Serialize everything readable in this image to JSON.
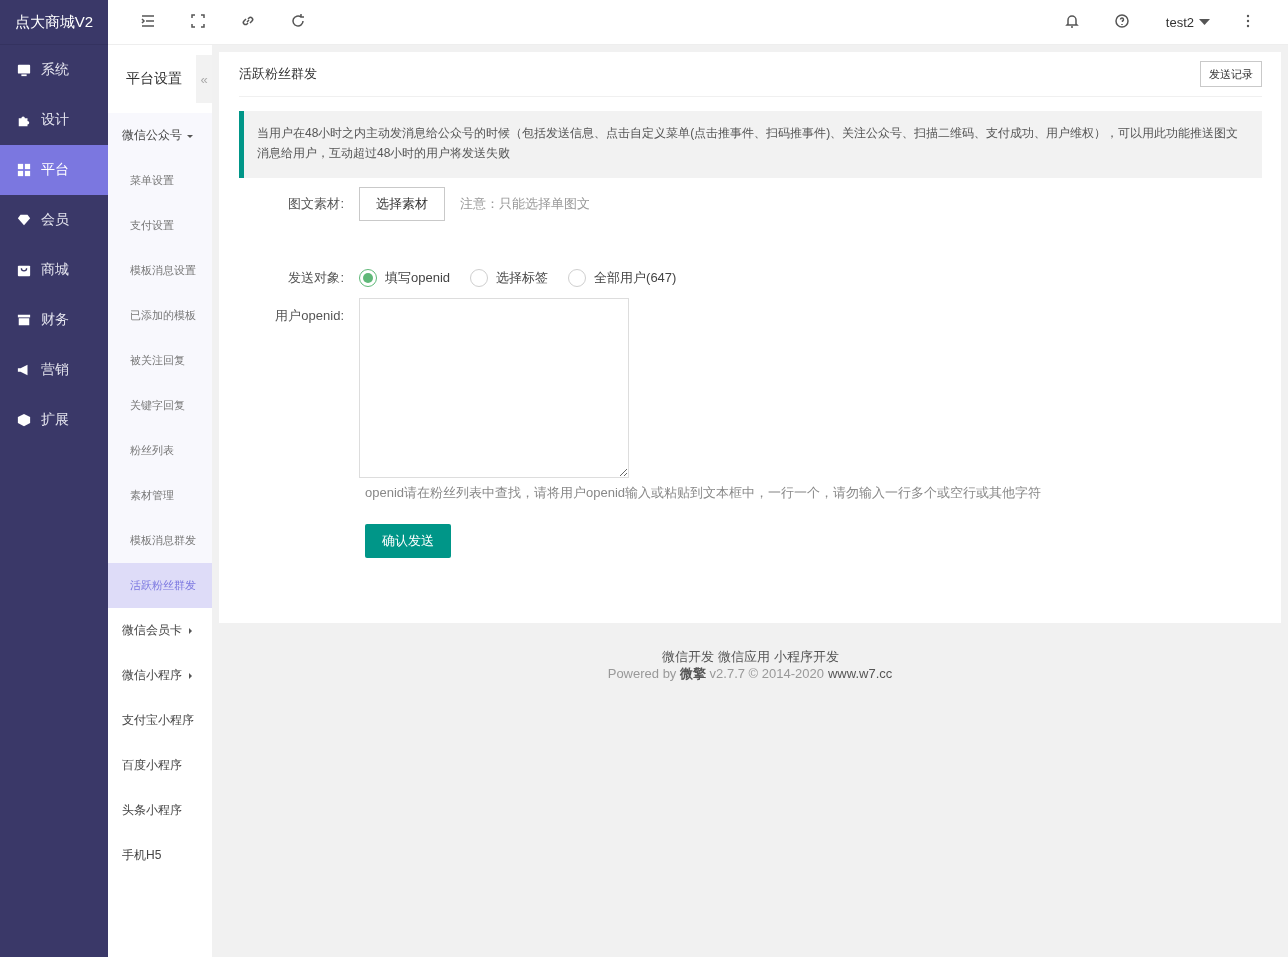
{
  "brand": "点大商城V2",
  "nav": [
    {
      "label": "系统",
      "selected": false
    },
    {
      "label": "设计",
      "selected": false
    },
    {
      "label": "平台",
      "selected": true
    },
    {
      "label": "会员",
      "selected": false
    },
    {
      "label": "商城",
      "selected": false
    },
    {
      "label": "财务",
      "selected": false
    },
    {
      "label": "营销",
      "selected": false
    },
    {
      "label": "扩展",
      "selected": false
    }
  ],
  "topbar": {
    "user": "test2"
  },
  "submenu": {
    "title": "平台设置",
    "collapse": "«",
    "groups": [
      {
        "label": "微信公众号",
        "expanded": true,
        "children": [
          {
            "label": "菜单设置",
            "selected": false
          },
          {
            "label": "支付设置",
            "selected": false
          },
          {
            "label": "模板消息设置",
            "selected": false
          },
          {
            "label": "已添加的模板",
            "selected": false
          },
          {
            "label": "被关注回复",
            "selected": false
          },
          {
            "label": "关键字回复",
            "selected": false
          },
          {
            "label": "粉丝列表",
            "selected": false
          },
          {
            "label": "素材管理",
            "selected": false
          },
          {
            "label": "模板消息群发",
            "selected": false
          },
          {
            "label": "活跃粉丝群发",
            "selected": true
          }
        ]
      },
      {
        "label": "微信会员卡",
        "expanded": false,
        "has_children": true
      },
      {
        "label": "微信小程序",
        "expanded": false,
        "has_children": true
      },
      {
        "label": "支付宝小程序",
        "expanded": false,
        "has_children": false
      },
      {
        "label": "百度小程序",
        "expanded": false,
        "has_children": false
      },
      {
        "label": "头条小程序",
        "expanded": false,
        "has_children": false
      },
      {
        "label": "手机H5",
        "expanded": false,
        "has_children": false
      }
    ]
  },
  "page": {
    "title": "活跃粉丝群发",
    "record_button": "发送记录",
    "notice": "当用户在48小时之内主动发消息给公众号的时候（包括发送信息、点击自定义菜单(点击推事件、扫码推事件)、关注公众号、扫描二维码、支付成功、用户维权），可以用此功能推送图文消息给用户，互动超过48小时的用户将发送失败",
    "material": {
      "label": "图文素材:",
      "button": "选择素材",
      "note": "注意：只能选择单图文"
    },
    "target": {
      "label": "发送对象:",
      "options": [
        {
          "label": "填写openid",
          "selected": true
        },
        {
          "label": "选择标签",
          "selected": false
        },
        {
          "label": "全部用户(647)",
          "selected": false
        }
      ]
    },
    "openid": {
      "label": "用户openid:",
      "help": "openid请在粉丝列表中查找，请将用户openid输入或粘贴到文本框中，一行一个，请勿输入一行多个或空行或其他字符"
    },
    "submit": "确认发送"
  },
  "footer": {
    "links": [
      "微信开发",
      "微信应用",
      "小程序开发"
    ],
    "powered": "Powered by **微擎** v2.7.7 © 2014-2020",
    "site": "www.w7.cc"
  }
}
